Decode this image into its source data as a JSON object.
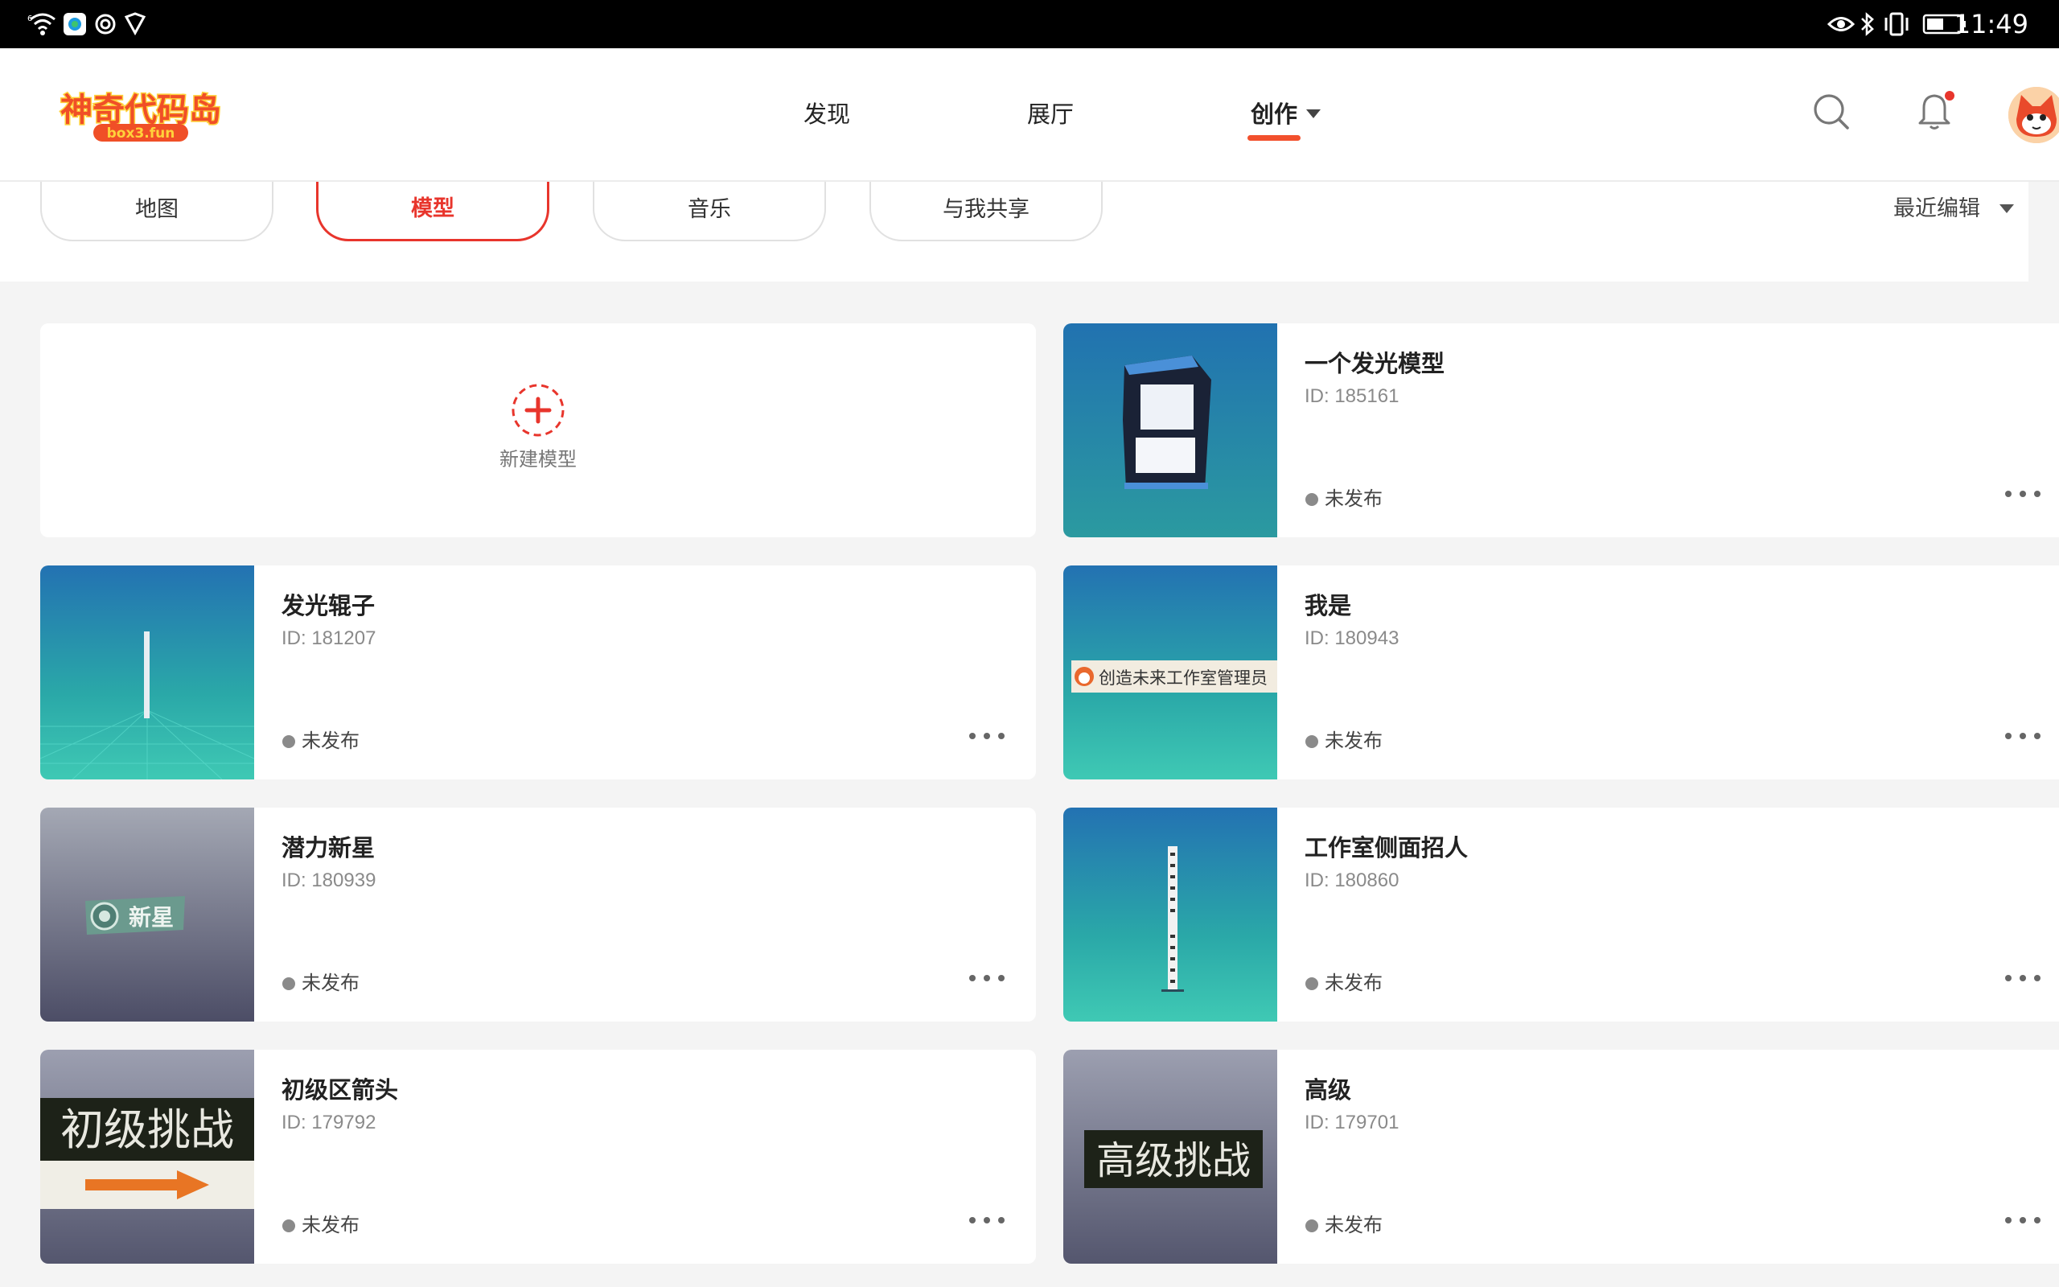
{
  "status_bar": {
    "time": "11:49",
    "left_icons": [
      "wifi-icon",
      "app-notification-icon",
      "sync-icon",
      "vpn-shield-icon"
    ],
    "right_icons": [
      "eye-icon",
      "bluetooth-icon",
      "vibrate-icon",
      "battery-icon"
    ]
  },
  "header": {
    "logo_text": "神奇代码岛",
    "logo_subtext": "box3.fun",
    "nav": [
      {
        "label": "发现",
        "active": false
      },
      {
        "label": "展厅",
        "active": false
      },
      {
        "label": "创作",
        "active": true
      }
    ],
    "accent_color": "#f2502d",
    "notification_dot": true
  },
  "filters": {
    "tabs": [
      {
        "label": "地图",
        "active": false
      },
      {
        "label": "模型",
        "active": true
      },
      {
        "label": "音乐",
        "active": false
      },
      {
        "label": "与我共享",
        "active": false
      }
    ],
    "sort_label": "最近编辑",
    "active_color": "#e8352c"
  },
  "new_model": {
    "label": "新建模型"
  },
  "models": [
    {
      "title": "一个发光模型",
      "id": "ID: 185161",
      "status": "未发布",
      "thumb": "glowing-box"
    },
    {
      "title": "发光辊子",
      "id": "ID: 181207",
      "status": "未发布",
      "thumb": "glowing-rod"
    },
    {
      "title": "我是",
      "id": "ID: 180943",
      "status": "未发布",
      "thumb": "name-banner",
      "thumb_text": "创造未来工作室管理员"
    },
    {
      "title": "潜力新星",
      "id": "ID: 180939",
      "status": "未发布",
      "thumb": "new-star-badge",
      "thumb_text": "新星"
    },
    {
      "title": "工作室侧面招人",
      "id": "ID: 180860",
      "status": "未发布",
      "thumb": "vertical-sign"
    },
    {
      "title": "初级区箭头",
      "id": "ID: 179792",
      "status": "未发布",
      "thumb": "beginner-arrow",
      "thumb_text": "初级挑战"
    },
    {
      "title": "高级",
      "id": "ID: 179701",
      "status": "未发布",
      "thumb": "advanced-sign",
      "thumb_text": "高级挑战"
    }
  ]
}
